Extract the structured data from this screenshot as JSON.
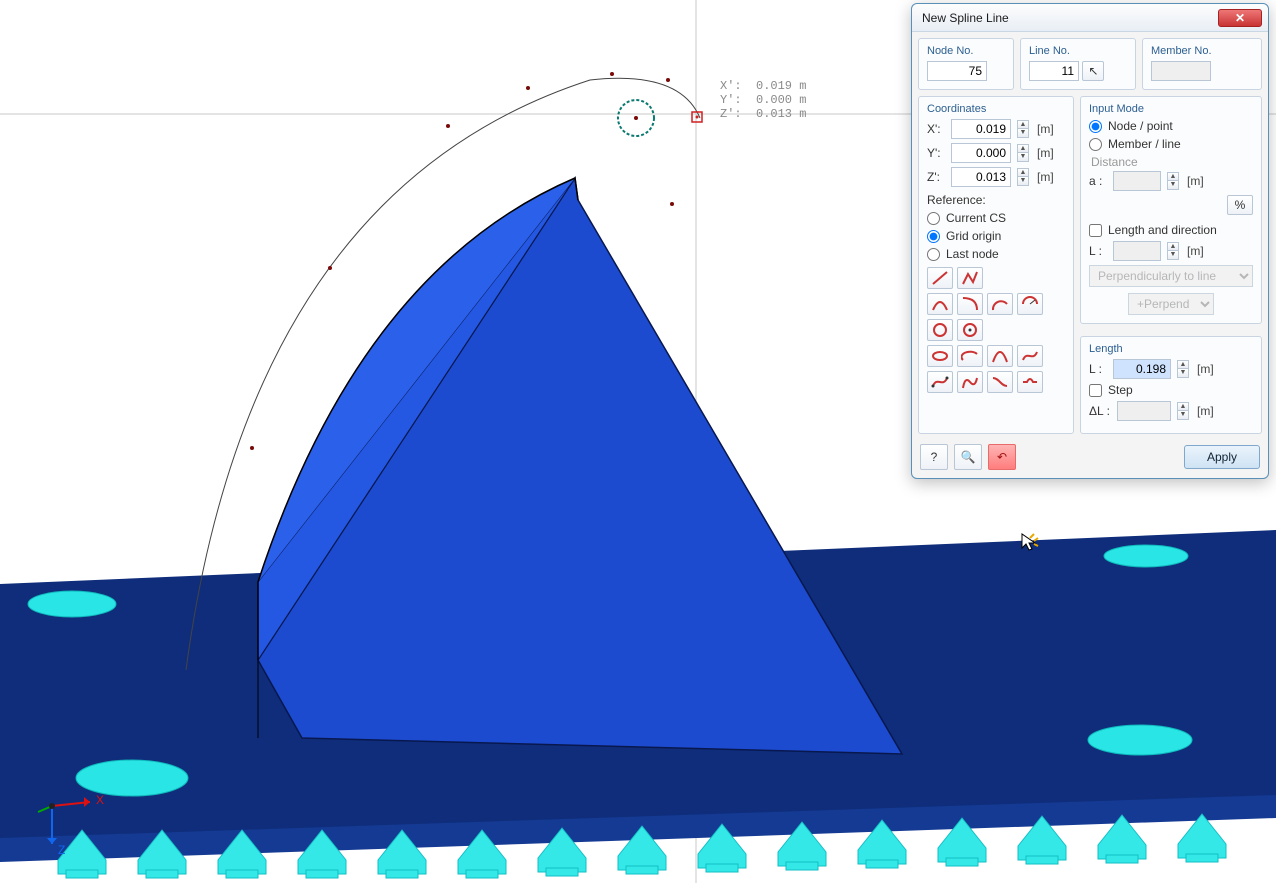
{
  "dialog": {
    "title": "New Spline Line",
    "close_x": "✕",
    "node": {
      "label": "Node No.",
      "value": "75"
    },
    "line": {
      "label": "Line No.",
      "value": "11"
    },
    "member": {
      "label": "Member No.",
      "value": ""
    },
    "coordinates": {
      "label": "Coordinates",
      "x": {
        "lbl": "X':",
        "val": "0.019",
        "unit": "[m]"
      },
      "y": {
        "lbl": "Y':",
        "val": "0.000",
        "unit": "[m]"
      },
      "z": {
        "lbl": "Z':",
        "val": "0.013",
        "unit": "[m]"
      },
      "ref_label": "Reference:",
      "ref_current": "Current CS",
      "ref_grid": "Grid origin",
      "ref_last": "Last node"
    },
    "input_mode": {
      "label": "Input Mode",
      "node": "Node / point",
      "member": "Member / line",
      "distance_lbl": "Distance",
      "a_lbl": "a :",
      "pct": "%",
      "len_dir": "Length and direction",
      "L_lbl": "L :",
      "unit": "[m]",
      "perp_sel": "Perpendicularly to line",
      "perp_btn": "+Perpend"
    },
    "length": {
      "label": "Length",
      "L_lbl": "L :",
      "L_val": "0.198",
      "unit": "[m]",
      "step_lbl": "Step",
      "dL_lbl": "ΔL :"
    },
    "tool_icons": [
      "line-icon",
      "polyline-icon",
      "arc-3pt-icon",
      "arc-tangent-icon",
      "arc-center-icon",
      "arc-radius-icon",
      "circle-icon",
      "circle-center-icon",
      "ellipse-icon",
      "elliptic-arc-icon",
      "parabola-icon",
      "spline-icon",
      "nurbs-icon",
      "bezier-icon",
      "s-curve-icon",
      "freehand-icon"
    ],
    "bottom": {
      "help": "?",
      "zoom": "🔍",
      "undo": "↶",
      "apply": "Apply"
    }
  },
  "viewport": {
    "coord_x": "X':  0.019 m",
    "coord_y": "Y':  0.000 m",
    "coord_z": "Z':  0.013 m",
    "axis_x": "X",
    "axis_z": "Z"
  }
}
